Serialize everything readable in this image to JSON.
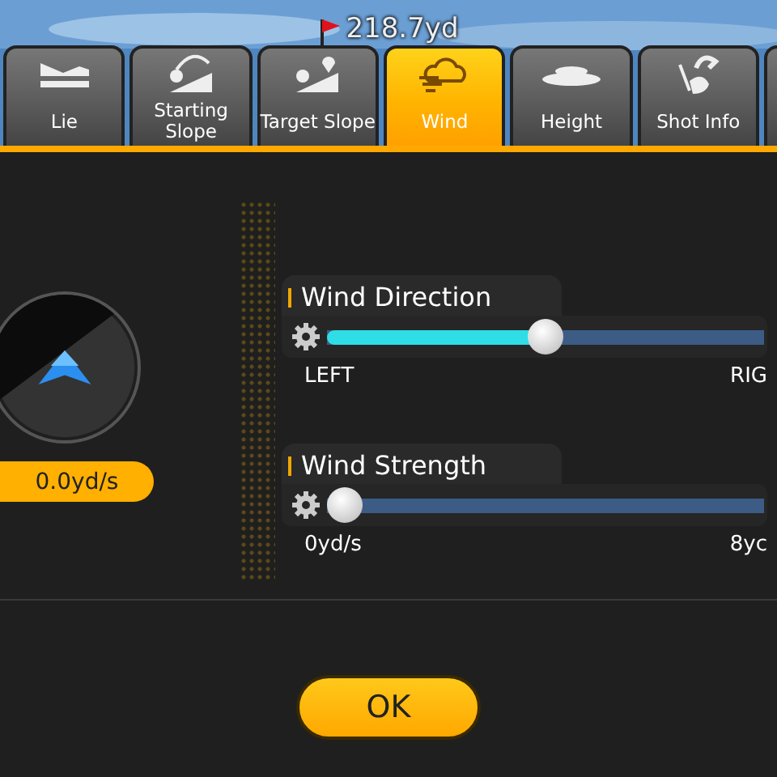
{
  "distance": {
    "value": "218.7yd"
  },
  "tabs": [
    {
      "label": "Lie",
      "selected": false
    },
    {
      "label": "Starting Slope",
      "selected": false
    },
    {
      "label": "Target Slope",
      "selected": false
    },
    {
      "label": "Wind",
      "selected": true
    },
    {
      "label": "Height",
      "selected": false
    },
    {
      "label": "Shot Info",
      "selected": false
    }
  ],
  "wind_display": {
    "speed": "0.0yd/s"
  },
  "sliders": [
    {
      "label": "Wind Direction",
      "level": 0.5,
      "min_label": "LEFT",
      "max_label": "RIG"
    },
    {
      "label": "Wind Strength",
      "level": 0,
      "min_label": "0yd/s",
      "max_label": "8yc"
    }
  ],
  "buttons": [
    {
      "label": "OK"
    }
  ]
}
